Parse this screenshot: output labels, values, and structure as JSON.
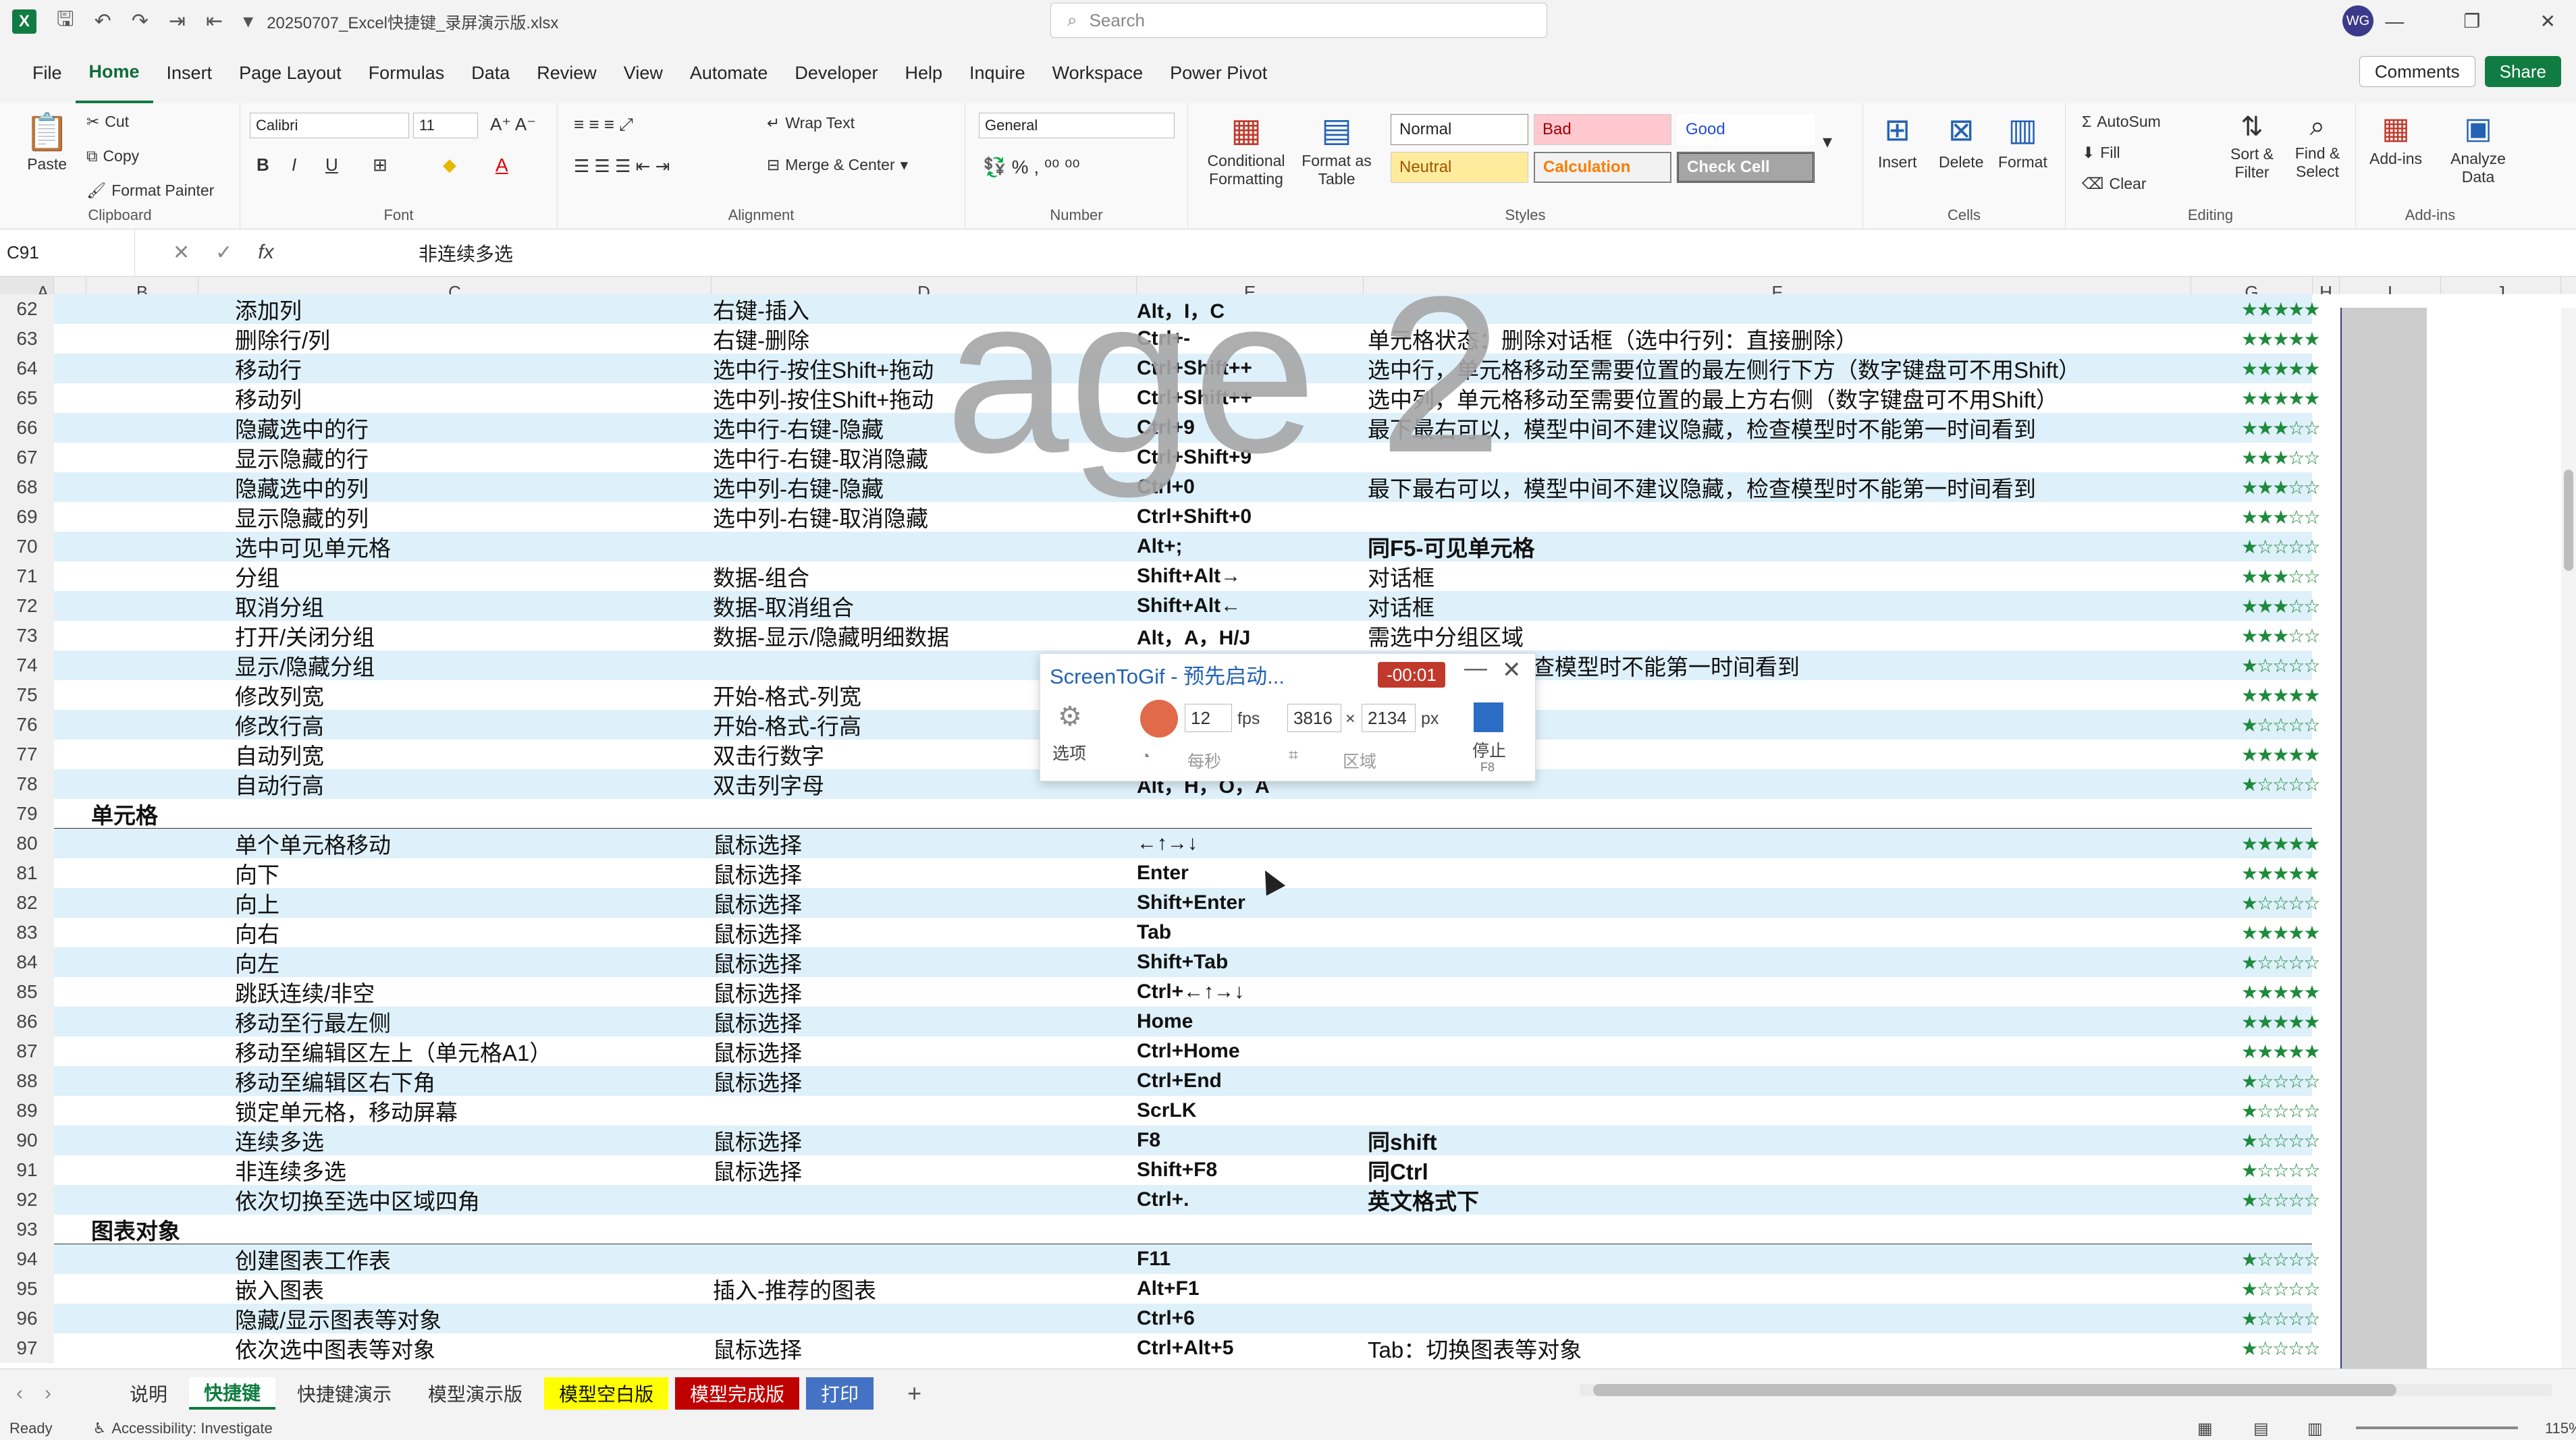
{
  "titlebar": {
    "filename": "20250707_Excel快捷键_录屏演示版.xlsx",
    "search_placeholder": "Search",
    "avatar_initials": "WG"
  },
  "menu": [
    "File",
    "Home",
    "Insert",
    "Page Layout",
    "Formulas",
    "Data",
    "Review",
    "View",
    "Automate",
    "Developer",
    "Help",
    "Inquire",
    "Workspace",
    "Power Pivot"
  ],
  "menu_right": {
    "comments": "Comments",
    "share": "Share"
  },
  "ribbon": {
    "clipboard": {
      "paste": "Paste",
      "cut": "Cut",
      "copy": "Copy",
      "format_painter": "Format Painter",
      "label": "Clipboard"
    },
    "font": {
      "family": "Calibri",
      "size": "11",
      "label": "Font",
      "bold": "B",
      "italic": "I",
      "underline": "U"
    },
    "alignment": {
      "wrap": "Wrap Text",
      "merge": "Merge & Center",
      "label": "Alignment"
    },
    "number": {
      "format": "General",
      "label": "Number"
    },
    "styles": {
      "cond": "Conditional Formatting",
      "table": "Format as Table",
      "normal": "Normal",
      "bad": "Bad",
      "good": "Good",
      "neutral": "Neutral",
      "calculation": "Calculation",
      "check": "Check Cell",
      "label": "Styles"
    },
    "cells": {
      "insert": "Insert",
      "delete": "Delete",
      "format": "Format",
      "label": "Cells"
    },
    "editing": {
      "autosum": "AutoSum",
      "fill": "Fill",
      "clear": "Clear",
      "sort": "Sort & Filter",
      "find": "Find & Select",
      "label": "Editing"
    },
    "addins": {
      "addins": "Add-ins",
      "analyze": "Analyze Data",
      "label": "Add-ins"
    }
  },
  "formula_bar": {
    "name_box": "C91",
    "content": "非连续多选"
  },
  "columns": [
    "A",
    "B",
    "C",
    "D",
    "E",
    "F",
    "G",
    "H",
    "I",
    "J"
  ],
  "watermark": "age 2",
  "rows": [
    {
      "n": "62",
      "c": "添加列",
      "d": "右键-插入",
      "e": "Alt，I，C",
      "f": "",
      "g": "★★★★★",
      "alt": true
    },
    {
      "n": "63",
      "c": "删除行/列",
      "d": "右键-删除",
      "e": "Ctrl+-",
      "f": "单元格状态：删除对话框（选中行列：直接删除）",
      "g": "★★★★★"
    },
    {
      "n": "64",
      "c": "移动行",
      "d": "选中行-按住Shift+拖动",
      "e": "Ctrl+Shift++",
      "f": "选中行，单元格移动至需要位置的最左侧行下方（数字键盘可不用Shift）",
      "g": "★★★★★",
      "alt": true
    },
    {
      "n": "65",
      "c": "移动列",
      "d": "选中列-按住Shift+拖动",
      "e": "Ctrl+Shift++",
      "f": "选中列，单元格移动至需要位置的最上方右侧（数字键盘可不用Shift）",
      "g": "★★★★★"
    },
    {
      "n": "66",
      "c": "隐藏选中的行",
      "d": "选中行-右键-隐藏",
      "e": "Ctrl+9",
      "f": "最下最右可以，模型中间不建议隐藏，检查模型时不能第一时间看到",
      "g": "★★★☆☆",
      "alt": true
    },
    {
      "n": "67",
      "c": "显示隐藏的行",
      "d": "选中行-右键-取消隐藏",
      "e": "Ctrl+Shift+9",
      "f": "",
      "g": "★★★☆☆"
    },
    {
      "n": "68",
      "c": "隐藏选中的列",
      "d": "选中列-右键-隐藏",
      "e": "Ctrl+0",
      "f": "最下最右可以，模型中间不建议隐藏，检查模型时不能第一时间看到",
      "g": "★★★☆☆",
      "alt": true
    },
    {
      "n": "69",
      "c": "显示隐藏的列",
      "d": "选中列-右键-取消隐藏",
      "e": "Ctrl+Shift+0",
      "f": "",
      "g": "★★★☆☆"
    },
    {
      "n": "70",
      "c": "选中可见单元格",
      "d": "",
      "e": "Alt+;",
      "f": "同F5-可见单元格",
      "fb": true,
      "g": "★☆☆☆☆",
      "alt": true
    },
    {
      "n": "71",
      "c": "分组",
      "d": "数据-组合",
      "e": "Shift+Alt→",
      "f": "对话框",
      "g": "★★★☆☆"
    },
    {
      "n": "72",
      "c": "取消分组",
      "d": "数据-取消组合",
      "e": "Shift+Alt←",
      "f": "对话框",
      "g": "★★★☆☆",
      "alt": true
    },
    {
      "n": "73",
      "c": "打开/关闭分组",
      "d": "数据-显示/隐藏明细数据",
      "e": "Alt，A，H/J",
      "f": "需选中分组区域",
      "g": "★★★☆☆"
    },
    {
      "n": "74",
      "c": "显示/隐藏分组",
      "d": "",
      "e": "",
      "f": "查模型时不能第一时间看到",
      "fx": true,
      "g": "★☆☆☆☆",
      "alt": true
    },
    {
      "n": "75",
      "c": "修改列宽",
      "d": "开始-格式-列宽",
      "e": "",
      "f": "",
      "g": "★★★★★"
    },
    {
      "n": "76",
      "c": "修改行高",
      "d": "开始-格式-行高",
      "e": "",
      "f": "",
      "g": "★☆☆☆☆",
      "alt": true
    },
    {
      "n": "77",
      "c": "自动列宽",
      "d": "双击行数字",
      "e": "",
      "f": "",
      "g": "★★★★★"
    },
    {
      "n": "78",
      "c": "自动行高",
      "d": "双击列字母",
      "e": "Alt，H，O，A",
      "f": "",
      "g": "★☆☆☆☆",
      "alt": true
    },
    {
      "n": "79",
      "b": "单元格",
      "section": true
    },
    {
      "n": "80",
      "c": "单个单元格移动",
      "d": "鼠标选择",
      "e": "←↑→↓",
      "f": "",
      "g": "★★★★★",
      "alt": true
    },
    {
      "n": "81",
      "c": "向下",
      "d": "鼠标选择",
      "e": "Enter",
      "f": "",
      "g": "★★★★★"
    },
    {
      "n": "82",
      "c": "向上",
      "d": "鼠标选择",
      "e": "Shift+Enter",
      "f": "",
      "g": "★☆☆☆☆",
      "alt": true
    },
    {
      "n": "83",
      "c": "向右",
      "d": "鼠标选择",
      "e": "Tab",
      "f": "",
      "g": "★★★★★"
    },
    {
      "n": "84",
      "c": "向左",
      "d": "鼠标选择",
      "e": "Shift+Tab",
      "f": "",
      "g": "★☆☆☆☆",
      "alt": true
    },
    {
      "n": "85",
      "c": "跳跃连续/非空",
      "d": "鼠标选择",
      "e": "Ctrl+←↑→↓",
      "f": "",
      "g": "★★★★★"
    },
    {
      "n": "86",
      "c": "移动至行最左侧",
      "d": "鼠标选择",
      "e": "Home",
      "f": "",
      "g": "★★★★★",
      "alt": true
    },
    {
      "n": "87",
      "c": "移动至编辑区左上（单元格A1）",
      "d": "鼠标选择",
      "e": "Ctrl+Home",
      "f": "",
      "g": "★★★★★"
    },
    {
      "n": "88",
      "c": "移动至编辑区右下角",
      "d": "鼠标选择",
      "e": "Ctrl+End",
      "f": "",
      "g": "★☆☆☆☆",
      "alt": true
    },
    {
      "n": "89",
      "c": "锁定单元格，移动屏幕",
      "d": "",
      "e": "ScrLK",
      "f": "",
      "g": "★☆☆☆☆"
    },
    {
      "n": "90",
      "c": "连续多选",
      "d": "鼠标选择",
      "e": "F8",
      "f": "同shift",
      "fb": true,
      "g": "★☆☆☆☆",
      "alt": true
    },
    {
      "n": "91",
      "c": "非连续多选",
      "d": "鼠标选择",
      "e": "Shift+F8",
      "f": "同Ctrl",
      "fb": true,
      "g": "★☆☆☆☆"
    },
    {
      "n": "92",
      "c": "依次切换至选中区域四角",
      "d": "",
      "e": "Ctrl+.",
      "f": "英文格式下",
      "fb": true,
      "g": "★☆☆☆☆",
      "alt": true
    },
    {
      "n": "93",
      "b": "图表对象",
      "section": true
    },
    {
      "n": "94",
      "c": "创建图表工作表",
      "d": "",
      "e": "F11",
      "f": "",
      "g": "★☆☆☆☆",
      "alt": true
    },
    {
      "n": "95",
      "c": "嵌入图表",
      "d": "插入-推荐的图表",
      "e": "Alt+F1",
      "f": "",
      "g": "★☆☆☆☆"
    },
    {
      "n": "96",
      "c": "隐藏/显示图表等对象",
      "d": "",
      "e": "Ctrl+6",
      "f": "",
      "g": "★☆☆☆☆",
      "alt": true
    },
    {
      "n": "97",
      "c": "依次选中图表等对象",
      "d": "鼠标选择",
      "e": "Ctrl+Alt+5",
      "f": "Tab：切换图表等对象",
      "g": "★☆☆☆☆"
    }
  ],
  "sheet_tabs": [
    {
      "label": "说明",
      "bg": "",
      "color": "#333"
    },
    {
      "label": "快捷键",
      "bg": "#ffffff",
      "color": "#107c41",
      "active": true
    },
    {
      "label": "快捷键演示",
      "bg": "",
      "color": "#333"
    },
    {
      "label": "模型演示版",
      "bg": "",
      "color": "#333"
    },
    {
      "label": "模型空白版",
      "bg": "#ffff00",
      "color": "#111"
    },
    {
      "label": "模型完成版",
      "bg": "#c00000",
      "color": "#ffffff"
    },
    {
      "label": "打印",
      "bg": "#4472c4",
      "color": "#ffffff"
    }
  ],
  "status": {
    "ready": "Ready",
    "accessibility": "Accessibility: Investigate",
    "zoom": "115%"
  },
  "screentogif": {
    "title": "ScreenToGif - 预先启动...",
    "timer": "-00:01",
    "options": "选项",
    "fps_value": "12",
    "fps": "fps",
    "width": "3816",
    "x": "×",
    "height": "2134",
    "px": "px",
    "per_second": "每秒",
    "region": "区域",
    "stop": "停止",
    "stop_key": "F8"
  }
}
